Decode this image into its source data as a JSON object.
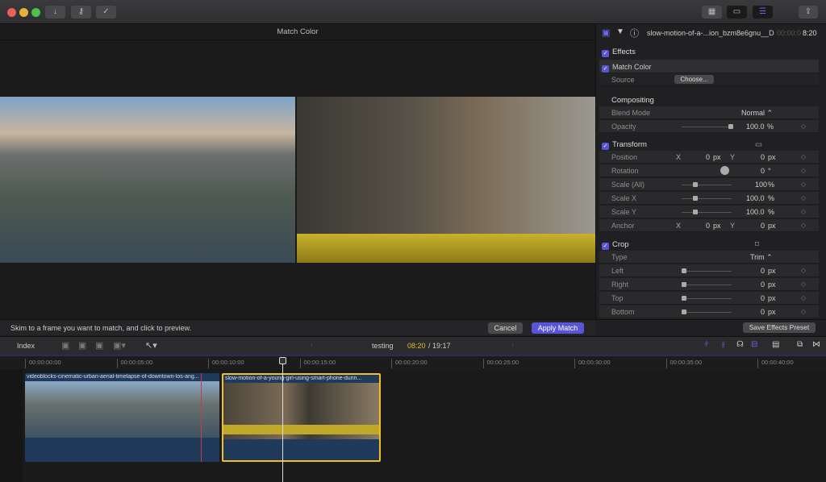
{
  "toolbar": {
    "import_icon": "download-arrow-icon",
    "keywords_icon": "key-icon",
    "background_tasks_icon": "checkmark-circle-icon",
    "browser_icon": "grid-icon",
    "timeline_icon": "timeline-icon",
    "inspector_icon": "sliders-icon",
    "share_icon": "share-icon"
  },
  "viewer": {
    "title": "Match Color",
    "hint": "Skim to a frame you want to match, and click to preview.",
    "cancel": "Cancel",
    "apply": "Apply Match"
  },
  "inspector": {
    "clip_name": "slow-motion-of-a-...ion_bzm8e6gnu__D",
    "timecode_dim": "00:00:0",
    "timecode": "8:20",
    "effects": {
      "label": "Effects",
      "match_color": "Match Color",
      "source_label": "Source",
      "source_button": "Choose..."
    },
    "compositing": {
      "label": "Compositing",
      "blend_label": "Blend Mode",
      "blend_value": "Normal ⌃",
      "opacity_label": "Opacity",
      "opacity_value": "100.0",
      "opacity_unit": "%",
      "opacity_level": 100
    },
    "transform": {
      "label": "Transform",
      "position_label": "Position",
      "x": "X",
      "y": "Y",
      "pos_x": "0",
      "pos_y": "0",
      "px": "px",
      "rotation_label": "Rotation",
      "rotation_value": "0",
      "deg": "°",
      "scale_all_label": "Scale (All)",
      "scale_all": "100",
      "scale_x_label": "Scale X",
      "scale_x": "100.0",
      "scale_y_label": "Scale Y",
      "scale_y": "100.0",
      "pct": "%",
      "anchor_label": "Anchor",
      "anchor_x": "0",
      "anchor_y": "0"
    },
    "crop": {
      "label": "Crop",
      "type_label": "Type",
      "type_value": "Trim ⌃",
      "left_label": "Left",
      "right_label": "Right",
      "top_label": "Top",
      "bottom_label": "Bottom",
      "left": "0",
      "right": "0",
      "top": "0",
      "bottom": "0",
      "px": "px"
    },
    "save_preset": "Save Effects Preset"
  },
  "timeline": {
    "index": "Index",
    "project": "testing",
    "current": "08:20",
    "duration": "/ 19:17",
    "ticks": [
      "00:00:00:00",
      "00:00:05:00",
      "00:00:10:00",
      "00:00:15:00",
      "00:00:20:00",
      "00:00:25:00",
      "00:00:30:00",
      "00:00:35:00",
      "00:00:40:00"
    ],
    "clips": [
      {
        "name": "videoblocks-cinematic-urban-aerial-timelapse-of-downtown-los-ang..."
      },
      {
        "name": "slow-motion-of-a-young-girl-using-smart-phone-durin..."
      }
    ]
  },
  "colors": {
    "accent": "#5855d6",
    "timecode": "#e8b730",
    "selected_clip": "#f0c020",
    "clip": "#203a5c"
  }
}
